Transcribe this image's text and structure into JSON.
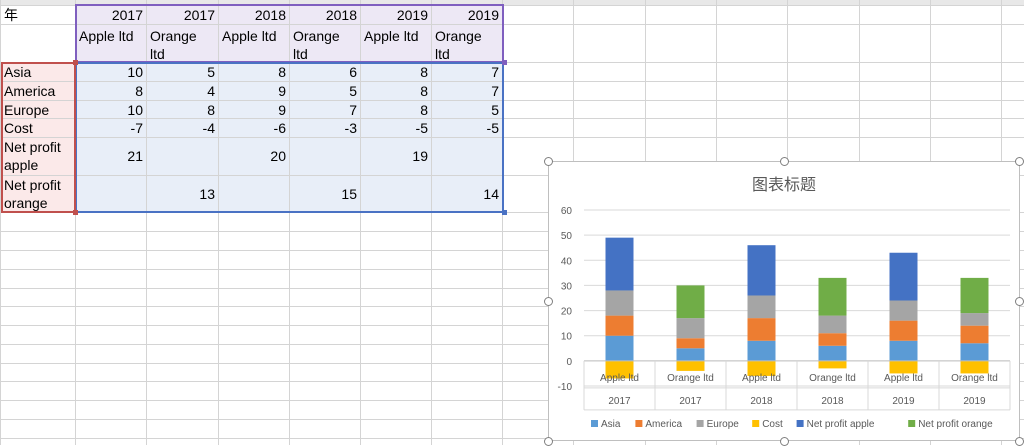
{
  "sheet": {
    "header_cell": "年",
    "years": [
      "2017",
      "2017",
      "2018",
      "2018",
      "2019",
      "2019"
    ],
    "companies": [
      "Apple ltd",
      "Orange ltd",
      "Apple ltd",
      "Orange ltd",
      "Apple ltd",
      "Orange ltd"
    ],
    "rows": [
      {
        "label": "Asia",
        "values": [
          "10",
          "5",
          "8",
          "6",
          "8",
          "7"
        ]
      },
      {
        "label": "America",
        "values": [
          "8",
          "4",
          "9",
          "5",
          "8",
          "7"
        ]
      },
      {
        "label": "Europe",
        "values": [
          "10",
          "8",
          "9",
          "7",
          "8",
          "5"
        ]
      },
      {
        "label": "Cost",
        "values": [
          "-7",
          "-4",
          "-6",
          "-3",
          "-5",
          "-5"
        ]
      },
      {
        "label": "Net profit apple",
        "values": [
          "21",
          "",
          "20",
          "",
          "19",
          ""
        ]
      },
      {
        "label": "Net profit orange",
        "values": [
          "",
          "13",
          "",
          "15",
          "",
          "14"
        ]
      }
    ]
  },
  "chart_data": {
    "type": "bar",
    "stacked": true,
    "title": "图表标题",
    "categories": [
      "Apple ltd",
      "Orange ltd",
      "Apple ltd",
      "Orange ltd",
      "Apple ltd",
      "Orange ltd"
    ],
    "category_groups": [
      "2017",
      "2017",
      "2018",
      "2018",
      "2019",
      "2019"
    ],
    "ylim": [
      -10,
      60
    ],
    "yticks": [
      -10,
      0,
      10,
      20,
      30,
      40,
      50,
      60
    ],
    "grid": true,
    "legend": "bottom",
    "series": [
      {
        "name": "Asia",
        "color": "#5b9bd5",
        "values": [
          10,
          5,
          8,
          6,
          8,
          7
        ]
      },
      {
        "name": "America",
        "color": "#ed7d31",
        "values": [
          8,
          4,
          9,
          5,
          8,
          7
        ]
      },
      {
        "name": "Europe",
        "color": "#a5a5a5",
        "values": [
          10,
          8,
          9,
          7,
          8,
          5
        ]
      },
      {
        "name": "Cost",
        "color": "#ffc000",
        "values": [
          -7,
          -4,
          -6,
          -3,
          -5,
          -5
        ]
      },
      {
        "name": "Net profit apple",
        "color": "#4472c4",
        "values": [
          21,
          0,
          20,
          0,
          19,
          0
        ]
      },
      {
        "name": "Net profit orange",
        "color": "#70ad47",
        "values": [
          0,
          13,
          0,
          15,
          0,
          14
        ]
      }
    ]
  }
}
